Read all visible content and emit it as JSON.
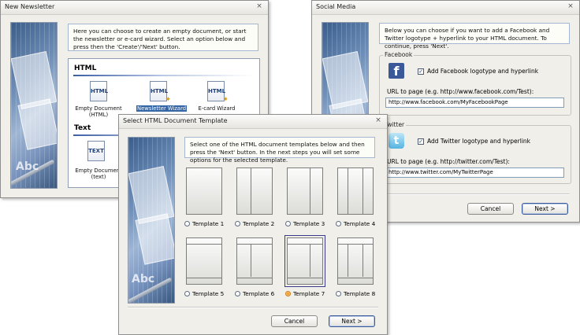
{
  "new_newsletter": {
    "title": "New Newsletter",
    "info": "Here you can choose to create an empty document, or start the newsletter or e-card wizard. Select an option below and press then the 'Create'/'Next' button.",
    "sections": {
      "html": "HTML",
      "text": "Text"
    },
    "items": [
      {
        "icon": "HTML",
        "label": "Empty Document (HTML)"
      },
      {
        "icon": "HTML",
        "label": "Newsletter Wizard"
      },
      {
        "icon": "HTML",
        "label": "E-card Wizard"
      },
      {
        "icon": "TEXT",
        "label": "Empty Document (text)"
      }
    ]
  },
  "social_media": {
    "title": "Social Media",
    "info": "Below you can choose if you want to add a Facebook and Twitter logotype + hyperlink to your HTML document. To continue, press 'Next'.",
    "facebook": {
      "group_label": "Facebook",
      "checkbox_label": "Add Facebook logotype and hyperlink",
      "checked": true,
      "url_label": "URL to page (e.g. http://www.facebook.com/Test):",
      "url_value": "http://www.facebook.com/MyFacebookPage"
    },
    "twitter": {
      "group_label": "Twitter",
      "checkbox_label": "Add Twitter logotype and hyperlink",
      "checked": true,
      "url_label": "URL to page (e.g. http://twitter.com/Test):",
      "url_value": "http://www.twitter.com/MyTwitterPage"
    },
    "cancel_label": "Cancel",
    "next_label": "Next >"
  },
  "template_dialog": {
    "title": "Select HTML Document Template",
    "info": "Select one of the HTML document templates below and then press the 'Next' button. In the next steps you will set some options for the selected template.",
    "templates": [
      {
        "label": "Template 1",
        "selected": false
      },
      {
        "label": "Template 2",
        "selected": false
      },
      {
        "label": "Template 3",
        "selected": false
      },
      {
        "label": "Template 4",
        "selected": false
      },
      {
        "label": "Template 5",
        "selected": false
      },
      {
        "label": "Template 6",
        "selected": false
      },
      {
        "label": "Template 7",
        "selected": true
      },
      {
        "label": "Template 8",
        "selected": false
      }
    ],
    "cancel_label": "Cancel",
    "next_label": "Next >"
  },
  "banner_text": "Abc",
  "close_glyph": "×",
  "colors": {
    "accent_blue": "#3465a4",
    "facebook_blue": "#3b5998",
    "selection_orange": "#f2a23b"
  }
}
